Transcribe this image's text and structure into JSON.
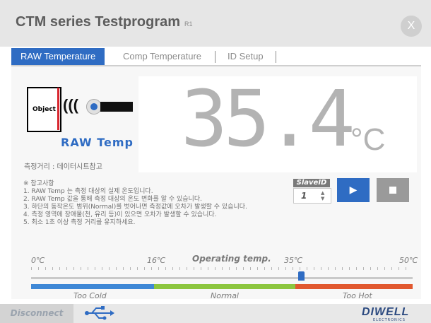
{
  "window": {
    "title": "CTM series Testprogram",
    "version": "R1",
    "close_label": "X"
  },
  "tabs": [
    {
      "label": "RAW Temperature",
      "active": true
    },
    {
      "label": "Comp Temperature",
      "active": false
    },
    {
      "label": "ID Setup",
      "active": false
    }
  ],
  "sensor": {
    "object_label": "Object",
    "mode_label": "RAW Temp",
    "distance_text": "측정거리 : 데이터시트참고"
  },
  "display": {
    "value": "35.4",
    "unit": "°C"
  },
  "notes": {
    "heading": "※ 참고사항",
    "lines": [
      "1. RAW Temp 는 측정 대상의 실제 온도입니다.",
      "2. RAW Temp 값을 통해 측정 대상의 온도 변화를 알 수 있습니다.",
      "3. 하단의 동작온도 범위(Normal)를 벗어나면 측정값에 오차가 발생할 수 있습니다.",
      "4. 측정 영역에 장애물(천, 유리 등)이 있으면 오차가 발생할 수 있습니다.",
      "5. 최소 1초 이상 측정 거리를 유지하세요."
    ]
  },
  "controls": {
    "slave_label": "SlaveID",
    "slave_value": "1",
    "play_icon": "play-icon",
    "stop_icon": "stop-icon"
  },
  "scale": {
    "title": "Operating temp.",
    "min_label": "0℃",
    "t1_label": "16℃",
    "t2_label": "35℃",
    "max_label": "50℃",
    "marker_value": 35.4,
    "ranges": [
      {
        "label": "Too Cold",
        "color": "#3f88d6"
      },
      {
        "label": "Normal",
        "color": "#8cc63f"
      },
      {
        "label": "Too Hot",
        "color": "#e1582f"
      }
    ]
  },
  "footer": {
    "disconnect_label": "Disconnect",
    "usb_icon": "usb-icon",
    "brand": "DIWELL",
    "brand_sub": "ELECTRONICS"
  },
  "colors": {
    "accent": "#2f6cc3",
    "title_bar": "#e6e6e6"
  }
}
